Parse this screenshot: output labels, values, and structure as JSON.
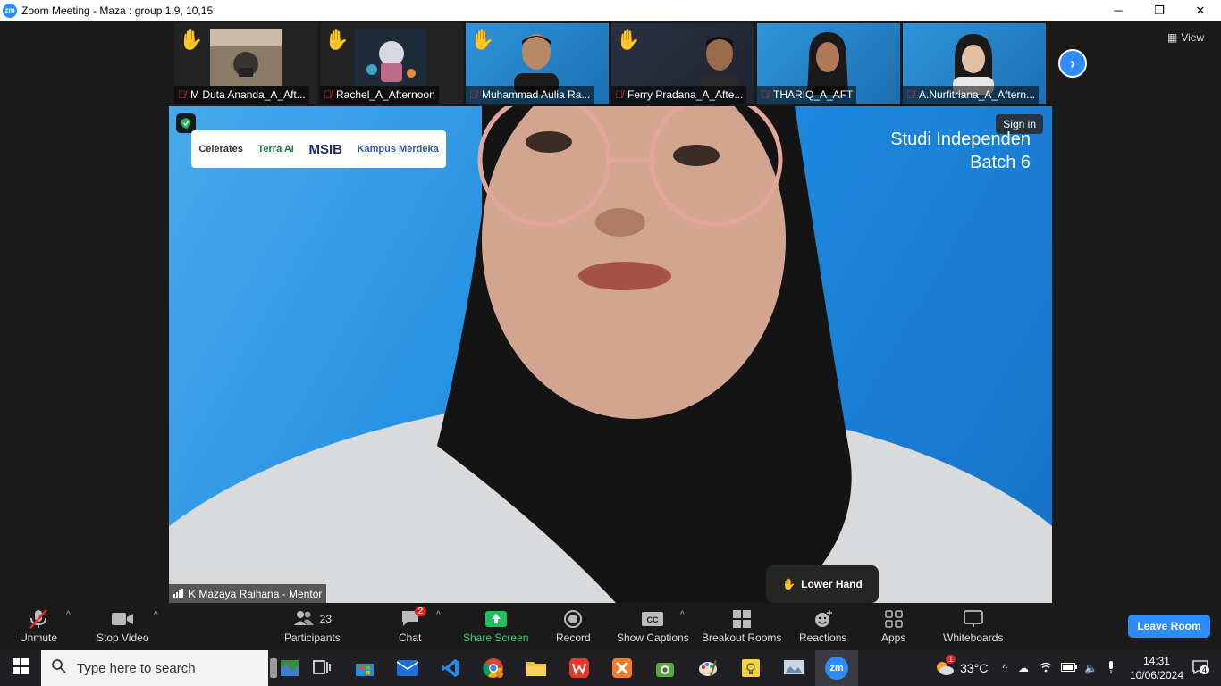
{
  "window": {
    "title": "Zoom Meeting - Maza : group 1,9, 10,15",
    "minimize": "─",
    "restore": "❐",
    "close": "✕"
  },
  "view_label": "View",
  "participants_strip": [
    {
      "name": "M Duta Ananda_A_Aft...",
      "hand": true
    },
    {
      "name": "Rachel_A_Afternoon",
      "hand": true
    },
    {
      "name": "Muhammad Aulia Ra...",
      "hand": true
    },
    {
      "name": "Ferry Pradana_A_Afte...",
      "hand": true
    },
    {
      "name": "THARIQ_A_AFT",
      "hand": false
    },
    {
      "name": "A.Nurfitriana_A_Aftern...",
      "hand": false
    }
  ],
  "main_video": {
    "speaker": "K Mazaya Raihana - Mentor",
    "signin": "Sign in",
    "banner_line1": "Studi Independen",
    "banner_line2": "Batch 6",
    "logos": [
      "Celerates",
      "Terra AI",
      "MSIB",
      "Kampus Merdeka"
    ],
    "lower_hand": "Lower Hand"
  },
  "toolbar": {
    "unmute": "Unmute",
    "stop_video": "Stop Video",
    "participants": "Participants",
    "participants_count": "23",
    "chat": "Chat",
    "chat_badge": "2",
    "share_screen": "Share Screen",
    "record": "Record",
    "show_captions": "Show Captions",
    "breakout_rooms": "Breakout Rooms",
    "reactions": "Reactions",
    "apps": "Apps",
    "whiteboards": "Whiteboards",
    "leave_room": "Leave Room"
  },
  "taskbar": {
    "search_placeholder": "Type here to search",
    "weather": "33°C",
    "time": "14:31",
    "date": "10/06/2024",
    "notification_count": "4",
    "weather_badge": "1"
  },
  "colors": {
    "accent": "#2d8cff",
    "share_green": "#1fc15a",
    "muted_red": "#e02828"
  }
}
